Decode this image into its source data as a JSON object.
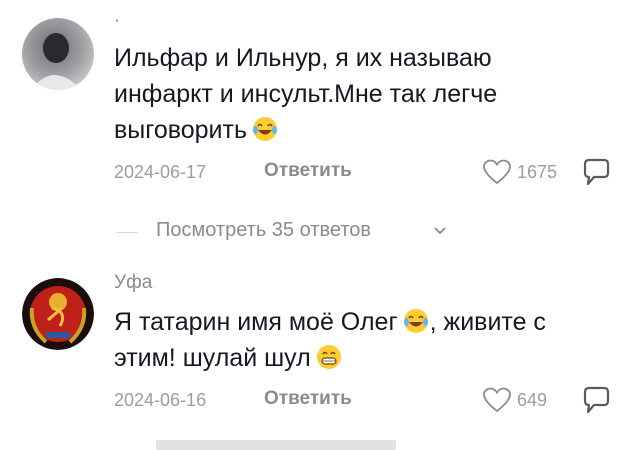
{
  "comments": [
    {
      "username": "·",
      "text": "Ильфар и Ильнур, я их называю инфаркт и инсульт.Мне так легче выговорить",
      "date": "2024-06-17",
      "reply_label": "Ответить",
      "likes": "1675"
    },
    {
      "username": "Уфа",
      "text_part1": "Я татарин имя моё Олег",
      "text_part2": ", живите с этим! шулай шул",
      "date": "2024-06-16",
      "reply_label": "Ответить",
      "likes": "649"
    }
  ],
  "view_replies": {
    "label": "Посмотреть 35 ответов"
  },
  "icons": {
    "like": "heart-outline-icon",
    "comment": "comment-bubble-icon",
    "laughing": "face-with-tears-of-joy-emoji",
    "grin": "grinning-face-emoji"
  },
  "colors": {
    "text": "#161823",
    "muted": "#8a8b91",
    "date": "#9c9ca3"
  }
}
